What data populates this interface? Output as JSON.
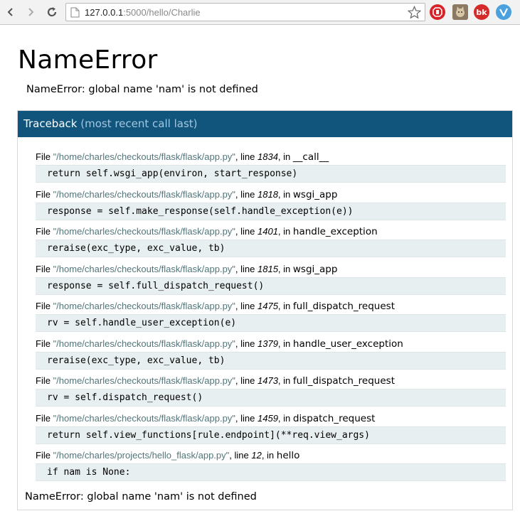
{
  "browser": {
    "url_host": "127.0.0.1",
    "url_rest": ":5000/hello/Charlie",
    "extensions": [
      "adblock-icon",
      "cat-extension-icon",
      "bk-extension-icon",
      "v-extension-icon"
    ],
    "bk_label": "bk"
  },
  "error": {
    "title": "NameError",
    "summary": "NameError: global name 'nam' is not defined",
    "footer": "NameError: global name 'nam' is not defined"
  },
  "traceback": {
    "label": "Traceback",
    "sublabel": "(most recent call last)",
    "frames": [
      {
        "prefix": "File ",
        "filename": "\"/home/charles/checkouts/flask/flask/app.py\"",
        "line_label": ", line ",
        "lineno": "1834",
        "in_label": ", in ",
        "func": "__call__",
        "code": "return self.wsgi_app(environ, start_response)"
      },
      {
        "prefix": "File ",
        "filename": "\"/home/charles/checkouts/flask/flask/app.py\"",
        "line_label": ", line ",
        "lineno": "1818",
        "in_label": ", in ",
        "func": "wsgi_app",
        "code": "response = self.make_response(self.handle_exception(e))"
      },
      {
        "prefix": "File ",
        "filename": "\"/home/charles/checkouts/flask/flask/app.py\"",
        "line_label": ", line ",
        "lineno": "1401",
        "in_label": ", in ",
        "func": "handle_exception",
        "code": "reraise(exc_type, exc_value, tb)"
      },
      {
        "prefix": "File ",
        "filename": "\"/home/charles/checkouts/flask/flask/app.py\"",
        "line_label": ", line ",
        "lineno": "1815",
        "in_label": ", in ",
        "func": "wsgi_app",
        "code": "response = self.full_dispatch_request()"
      },
      {
        "prefix": "File ",
        "filename": "\"/home/charles/checkouts/flask/flask/app.py\"",
        "line_label": ", line ",
        "lineno": "1475",
        "in_label": ", in ",
        "func": "full_dispatch_request",
        "code": "rv = self.handle_user_exception(e)"
      },
      {
        "prefix": "File ",
        "filename": "\"/home/charles/checkouts/flask/flask/app.py\"",
        "line_label": ", line ",
        "lineno": "1379",
        "in_label": ", in ",
        "func": "handle_user_exception",
        "code": "reraise(exc_type, exc_value, tb)"
      },
      {
        "prefix": "File ",
        "filename": "\"/home/charles/checkouts/flask/flask/app.py\"",
        "line_label": ", line ",
        "lineno": "1473",
        "in_label": ", in ",
        "func": "full_dispatch_request",
        "code": "rv = self.dispatch_request()"
      },
      {
        "prefix": "File ",
        "filename": "\"/home/charles/checkouts/flask/flask/app.py\"",
        "line_label": ", line ",
        "lineno": "1459",
        "in_label": ", in ",
        "func": "dispatch_request",
        "code": "return self.view_functions[rule.endpoint](**req.view_args)"
      },
      {
        "prefix": "File ",
        "filename": "\"/home/charles/projects/hello_flask/app.py\"",
        "line_label": ", line ",
        "lineno": "12",
        "in_label": ", in ",
        "func": "hello",
        "code": "if nam is None:"
      }
    ]
  },
  "colors": {
    "header_bg": "#11557c",
    "filename": "#52757a",
    "code_bg": "#e8eff0"
  }
}
